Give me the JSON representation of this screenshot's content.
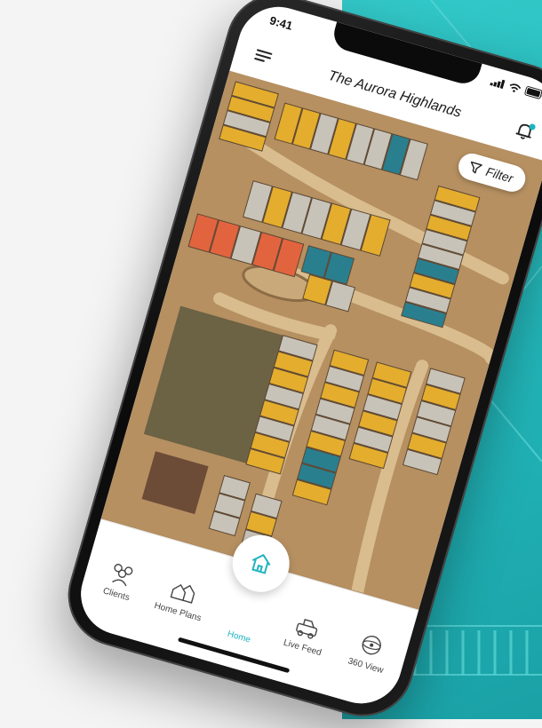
{
  "status_bar": {
    "time": "9:41"
  },
  "header": {
    "title": "The Aurora Highlands"
  },
  "map": {
    "filter_label": "Filter"
  },
  "tabs": [
    {
      "label": "Clients",
      "icon": "clients-icon"
    },
    {
      "label": "Home Plans",
      "icon": "home-plans-icon"
    },
    {
      "label": "Home",
      "icon": "home-icon",
      "active": true
    },
    {
      "label": "Live Feed",
      "icon": "live-feed-icon"
    },
    {
      "label": "360 View",
      "icon": "360-view-icon"
    }
  ],
  "colors": {
    "accent": "#1fb3c0",
    "lot_available": "#e4ad2d",
    "lot_sold": "#c8c3b8",
    "lot_reserved": "#2a7f8f",
    "lot_model": "#e2643e",
    "background_teal": "#27bcbe"
  }
}
